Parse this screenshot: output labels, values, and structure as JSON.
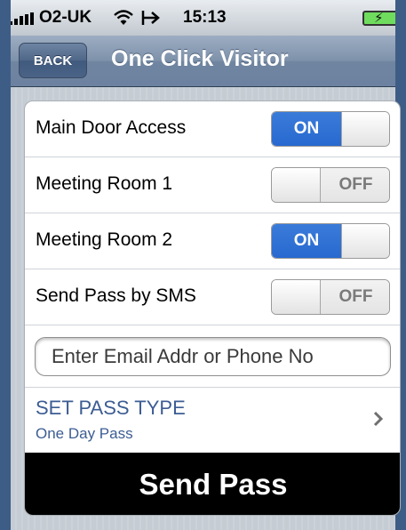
{
  "status_bar": {
    "carrier": "O2-UK",
    "time": "15:13",
    "icons": [
      "signal-icon",
      "wifi-icon",
      "arrow-icon",
      "battery-charging-icon"
    ],
    "battery_bolt": "⚡"
  },
  "nav": {
    "back_label": "BACK",
    "title": "One Click Visitor"
  },
  "settings": [
    {
      "label": "Main Door Access",
      "state": "ON",
      "on_label": "ON",
      "off_label": "OFF"
    },
    {
      "label": "Meeting Room 1",
      "state": "OFF",
      "on_label": "ON",
      "off_label": "OFF"
    },
    {
      "label": "Meeting Room 2",
      "state": "ON",
      "on_label": "ON",
      "off_label": "OFF"
    },
    {
      "label": "Send Pass by SMS",
      "state": "OFF",
      "on_label": "ON",
      "off_label": "OFF"
    }
  ],
  "contact": {
    "placeholder": "Enter Email Addr or Phone No",
    "value": ""
  },
  "pass_type": {
    "title": "SET PASS TYPE",
    "value": "One Day Pass"
  },
  "send_button": {
    "label": "Send Pass"
  },
  "colors": {
    "toggle_on": "#2f72d6",
    "nav_bar": "#7d91aa",
    "link_text": "#3c5d93",
    "send_button_bg": "#000000"
  }
}
